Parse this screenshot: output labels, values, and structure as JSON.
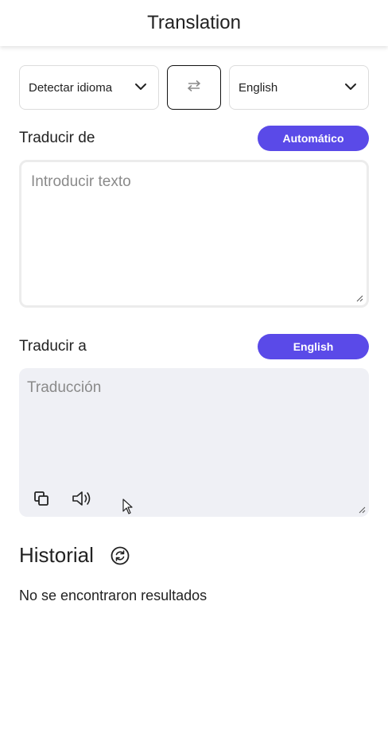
{
  "header": {
    "title": "Translation"
  },
  "source_select": {
    "value": "Detectar idioma",
    "icon": "chevron-down-icon"
  },
  "swap": {
    "icon": "swap-arrows-icon"
  },
  "target_select": {
    "value": "English",
    "icon": "chevron-down-icon"
  },
  "translate_from": {
    "label": "Traducir de",
    "mode_button": "Automático"
  },
  "source_input": {
    "placeholder": "Introducir texto",
    "value": ""
  },
  "translate_to": {
    "label": "Traducir a",
    "lang_button": "English"
  },
  "output": {
    "placeholder": "Traducción",
    "actions": [
      "copy-icon",
      "speaker-icon"
    ]
  },
  "history": {
    "title": "Historial",
    "refresh_icon": "refresh-icon",
    "empty_message": "No se encontraron resultados"
  },
  "colors": {
    "accent": "#5a4ae8",
    "output_bg": "#eff0f5",
    "border": "#dcdcdc"
  }
}
